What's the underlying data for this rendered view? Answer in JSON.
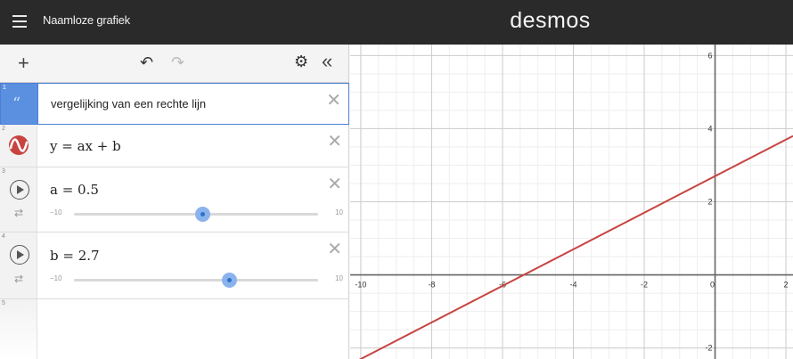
{
  "header": {
    "title": "Naamloze grafiek",
    "logo": "desmos"
  },
  "toolbar": {
    "add_icon": "plus-icon",
    "undo_icon": "undo-icon",
    "redo_icon": "redo-icon",
    "settings_icon": "gear-icon",
    "collapse_icon": "double-chevron-left-icon"
  },
  "expressions": [
    {
      "num": "1",
      "type": "note",
      "text": "vergelijking van een rechte lijn"
    },
    {
      "num": "2",
      "type": "expression",
      "latex": "y = ax + b",
      "color": "#c74440"
    },
    {
      "num": "3",
      "type": "slider",
      "var": "a",
      "text": "a = 0.5",
      "value": 0.5,
      "min": -10,
      "max": 10,
      "min_label": "−10",
      "max_label": "10"
    },
    {
      "num": "4",
      "type": "slider",
      "var": "b",
      "text": "b = 2.7",
      "value": 2.7,
      "min": -10,
      "max": 10,
      "min_label": "−10",
      "max_label": "10"
    },
    {
      "num": "5",
      "type": "empty"
    }
  ],
  "graph": {
    "x_range": [
      -10.3,
      2.2
    ],
    "y_range": [
      -2.3,
      6.3
    ],
    "x_ticks": [
      "-10",
      "-8",
      "-6",
      "-4",
      "-2",
      "0",
      "2"
    ],
    "y_ticks": [
      "6",
      "4",
      "2",
      "-2"
    ],
    "line_color": "#c74440",
    "grid_minor": "#eeeeee",
    "grid_major": "#cccccc",
    "axis_color": "#666666"
  }
}
